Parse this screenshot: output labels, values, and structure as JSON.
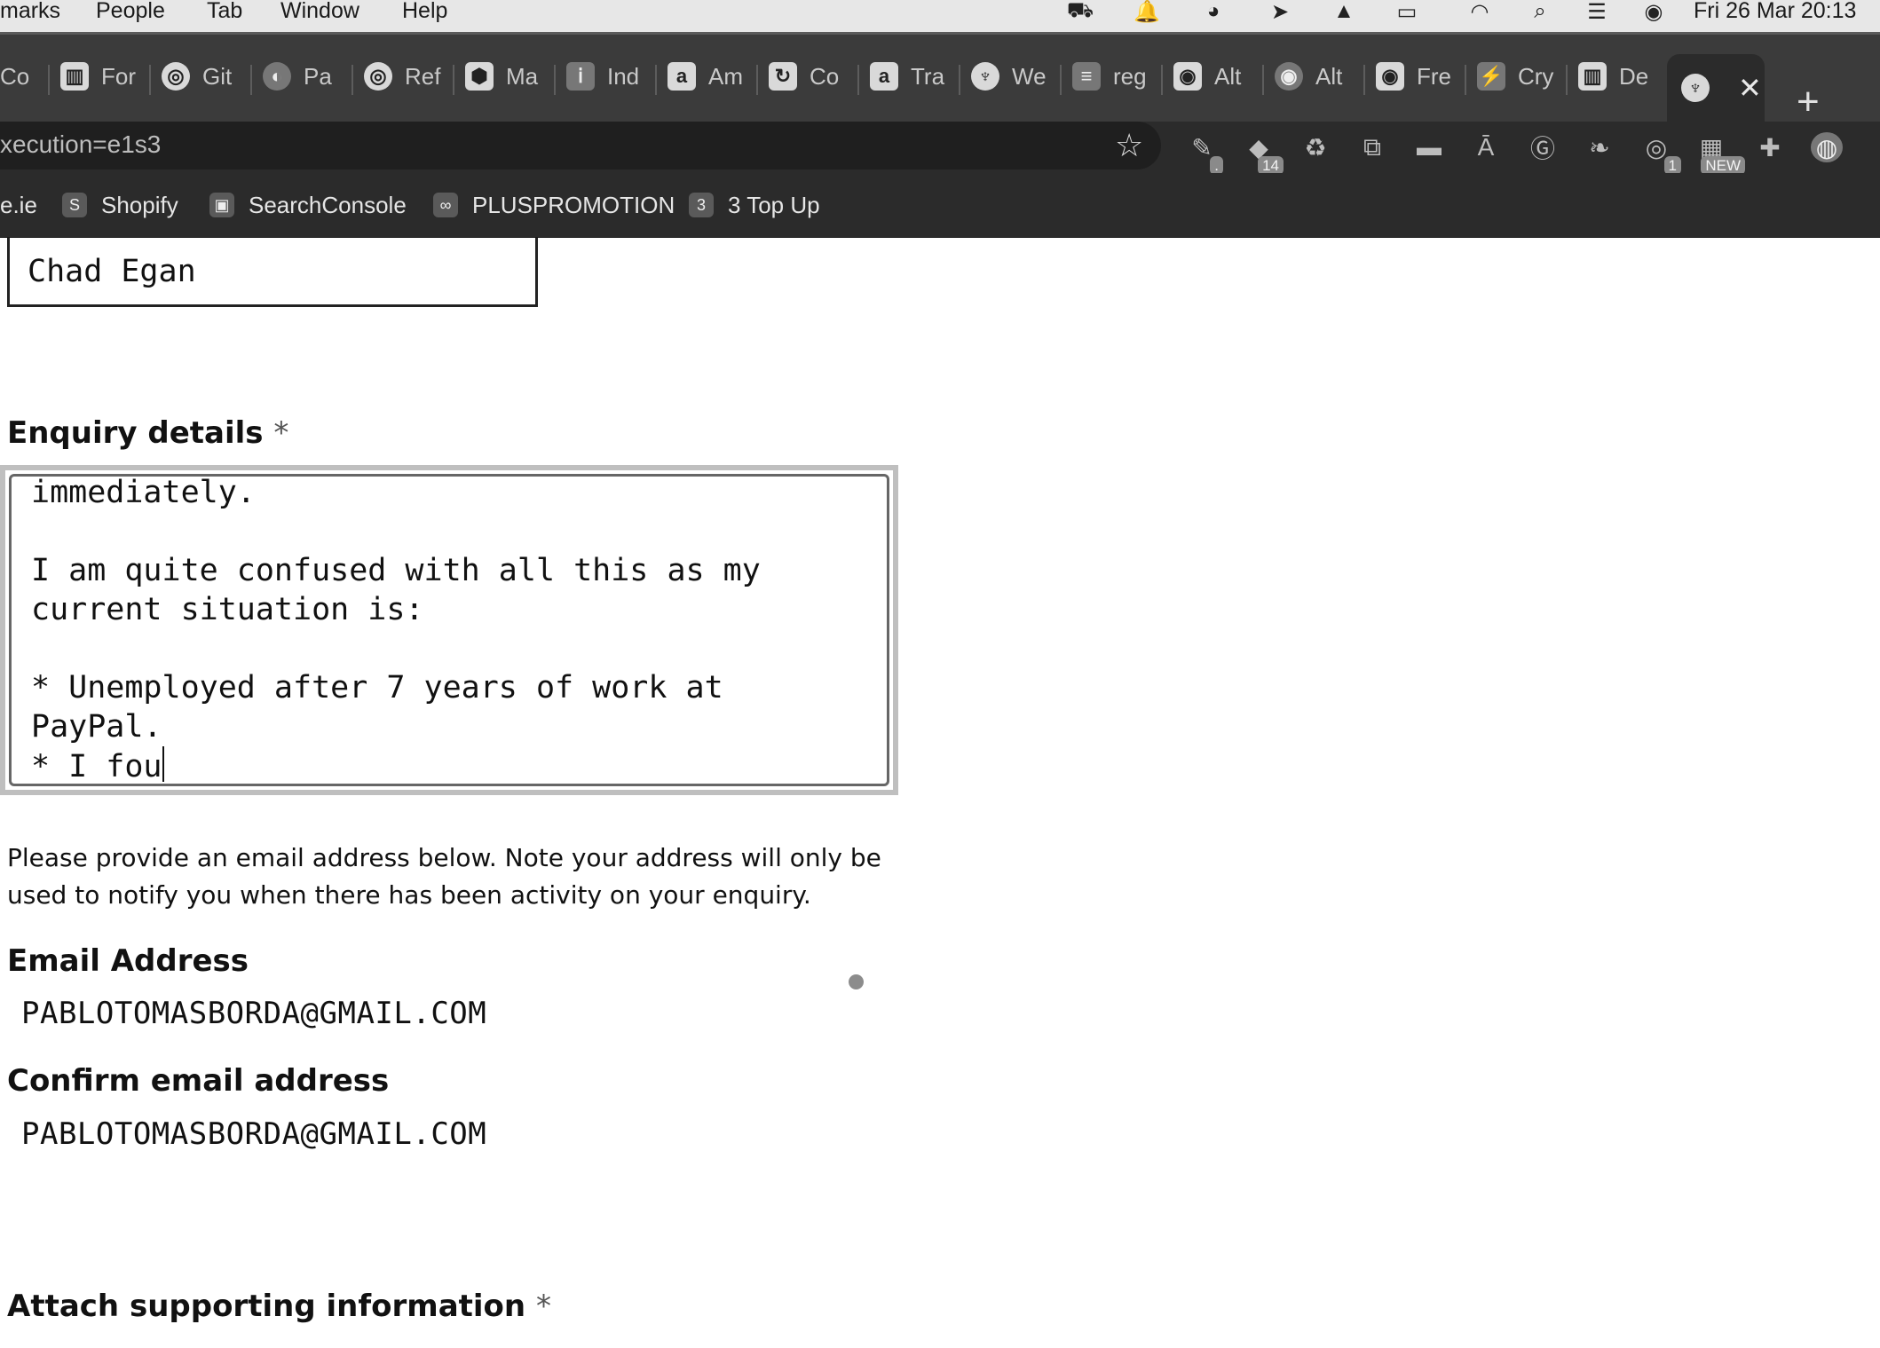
{
  "menubar": {
    "items": [
      "marks",
      "People",
      "Tab",
      "Window",
      "Help"
    ],
    "clock": "Fri 26 Mar  20:13"
  },
  "tabs": [
    {
      "label": "Co"
    },
    {
      "label": "For"
    },
    {
      "label": "Git"
    },
    {
      "label": "Pa"
    },
    {
      "label": "Ref"
    },
    {
      "label": "Ma"
    },
    {
      "label": "Ind"
    },
    {
      "label": "Am"
    },
    {
      "label": "Co"
    },
    {
      "label": "Tra"
    },
    {
      "label": "We"
    },
    {
      "label": "reg"
    },
    {
      "label": "Alt"
    },
    {
      "label": "Alt"
    },
    {
      "label": "Fre"
    },
    {
      "label": "Cry"
    },
    {
      "label": "De"
    }
  ],
  "omnibox": {
    "url": "xecution=e1s3"
  },
  "extensions": {
    "badge_14": "14",
    "badge_1": "1",
    "badge_new": "NEW"
  },
  "bookmarks": [
    {
      "label": "e.ie"
    },
    {
      "label": "Shopify"
    },
    {
      "label": "SearchConsole"
    },
    {
      "label": "PLUSPROMOTION"
    },
    {
      "label": "3 Top Up"
    }
  ],
  "form": {
    "name_value": "Chad Egan",
    "enquiry_label": "Enquiry details",
    "required_mark": "*",
    "enquiry_lines": [
      "immediately.",
      "",
      "I am quite confused with all this as my",
      "current situation is:",
      "",
      "* Unemployed after 7 years of work at",
      "PayPal.",
      "* I fou"
    ],
    "email_help": "Please provide an email address below. Note your address will only be used to notify you when there has been activity on your enquiry.",
    "email_label": "Email Address",
    "email_value": "PABLOTOMASBORDA@GMAIL.COM",
    "confirm_email_label": "Confirm email address",
    "confirm_email_value": "PABLOTOMASBORDA@GMAIL.COM",
    "attach_label": "Attach supporting information"
  }
}
